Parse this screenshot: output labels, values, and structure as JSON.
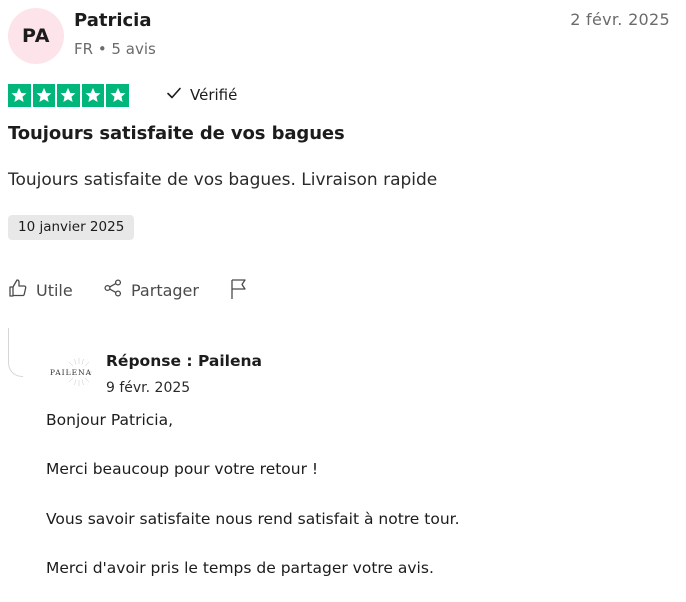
{
  "reviewer": {
    "initials": "PA",
    "name": "Patricia",
    "meta": "FR • 5 avis"
  },
  "review": {
    "date": "2 févr. 2025",
    "rating": 5,
    "rating_max": 5,
    "verified_label": "Vérifié",
    "title": "Toujours satisfaite de vos bagues",
    "text": "Toujours satisfaite de vos bagues. Livraison rapide",
    "experience_date": "10 janvier 2025"
  },
  "actions": {
    "useful_label": "Utile",
    "share_label": "Partager"
  },
  "reply": {
    "logo_text": "PAILENA",
    "title": "Réponse : Pailena",
    "date": "9 févr. 2025",
    "paragraphs": [
      "Bonjour Patricia,",
      "Merci beaucoup pour votre retour !",
      "Vous savoir satisfaite nous rend satisfait à notre tour.",
      "Merci d'avoir pris le temps de partager votre avis."
    ]
  },
  "colors": {
    "star_green": "#00b67a",
    "verified_check": "#1c1c1c",
    "avatar_bg": "#fde3ea"
  }
}
